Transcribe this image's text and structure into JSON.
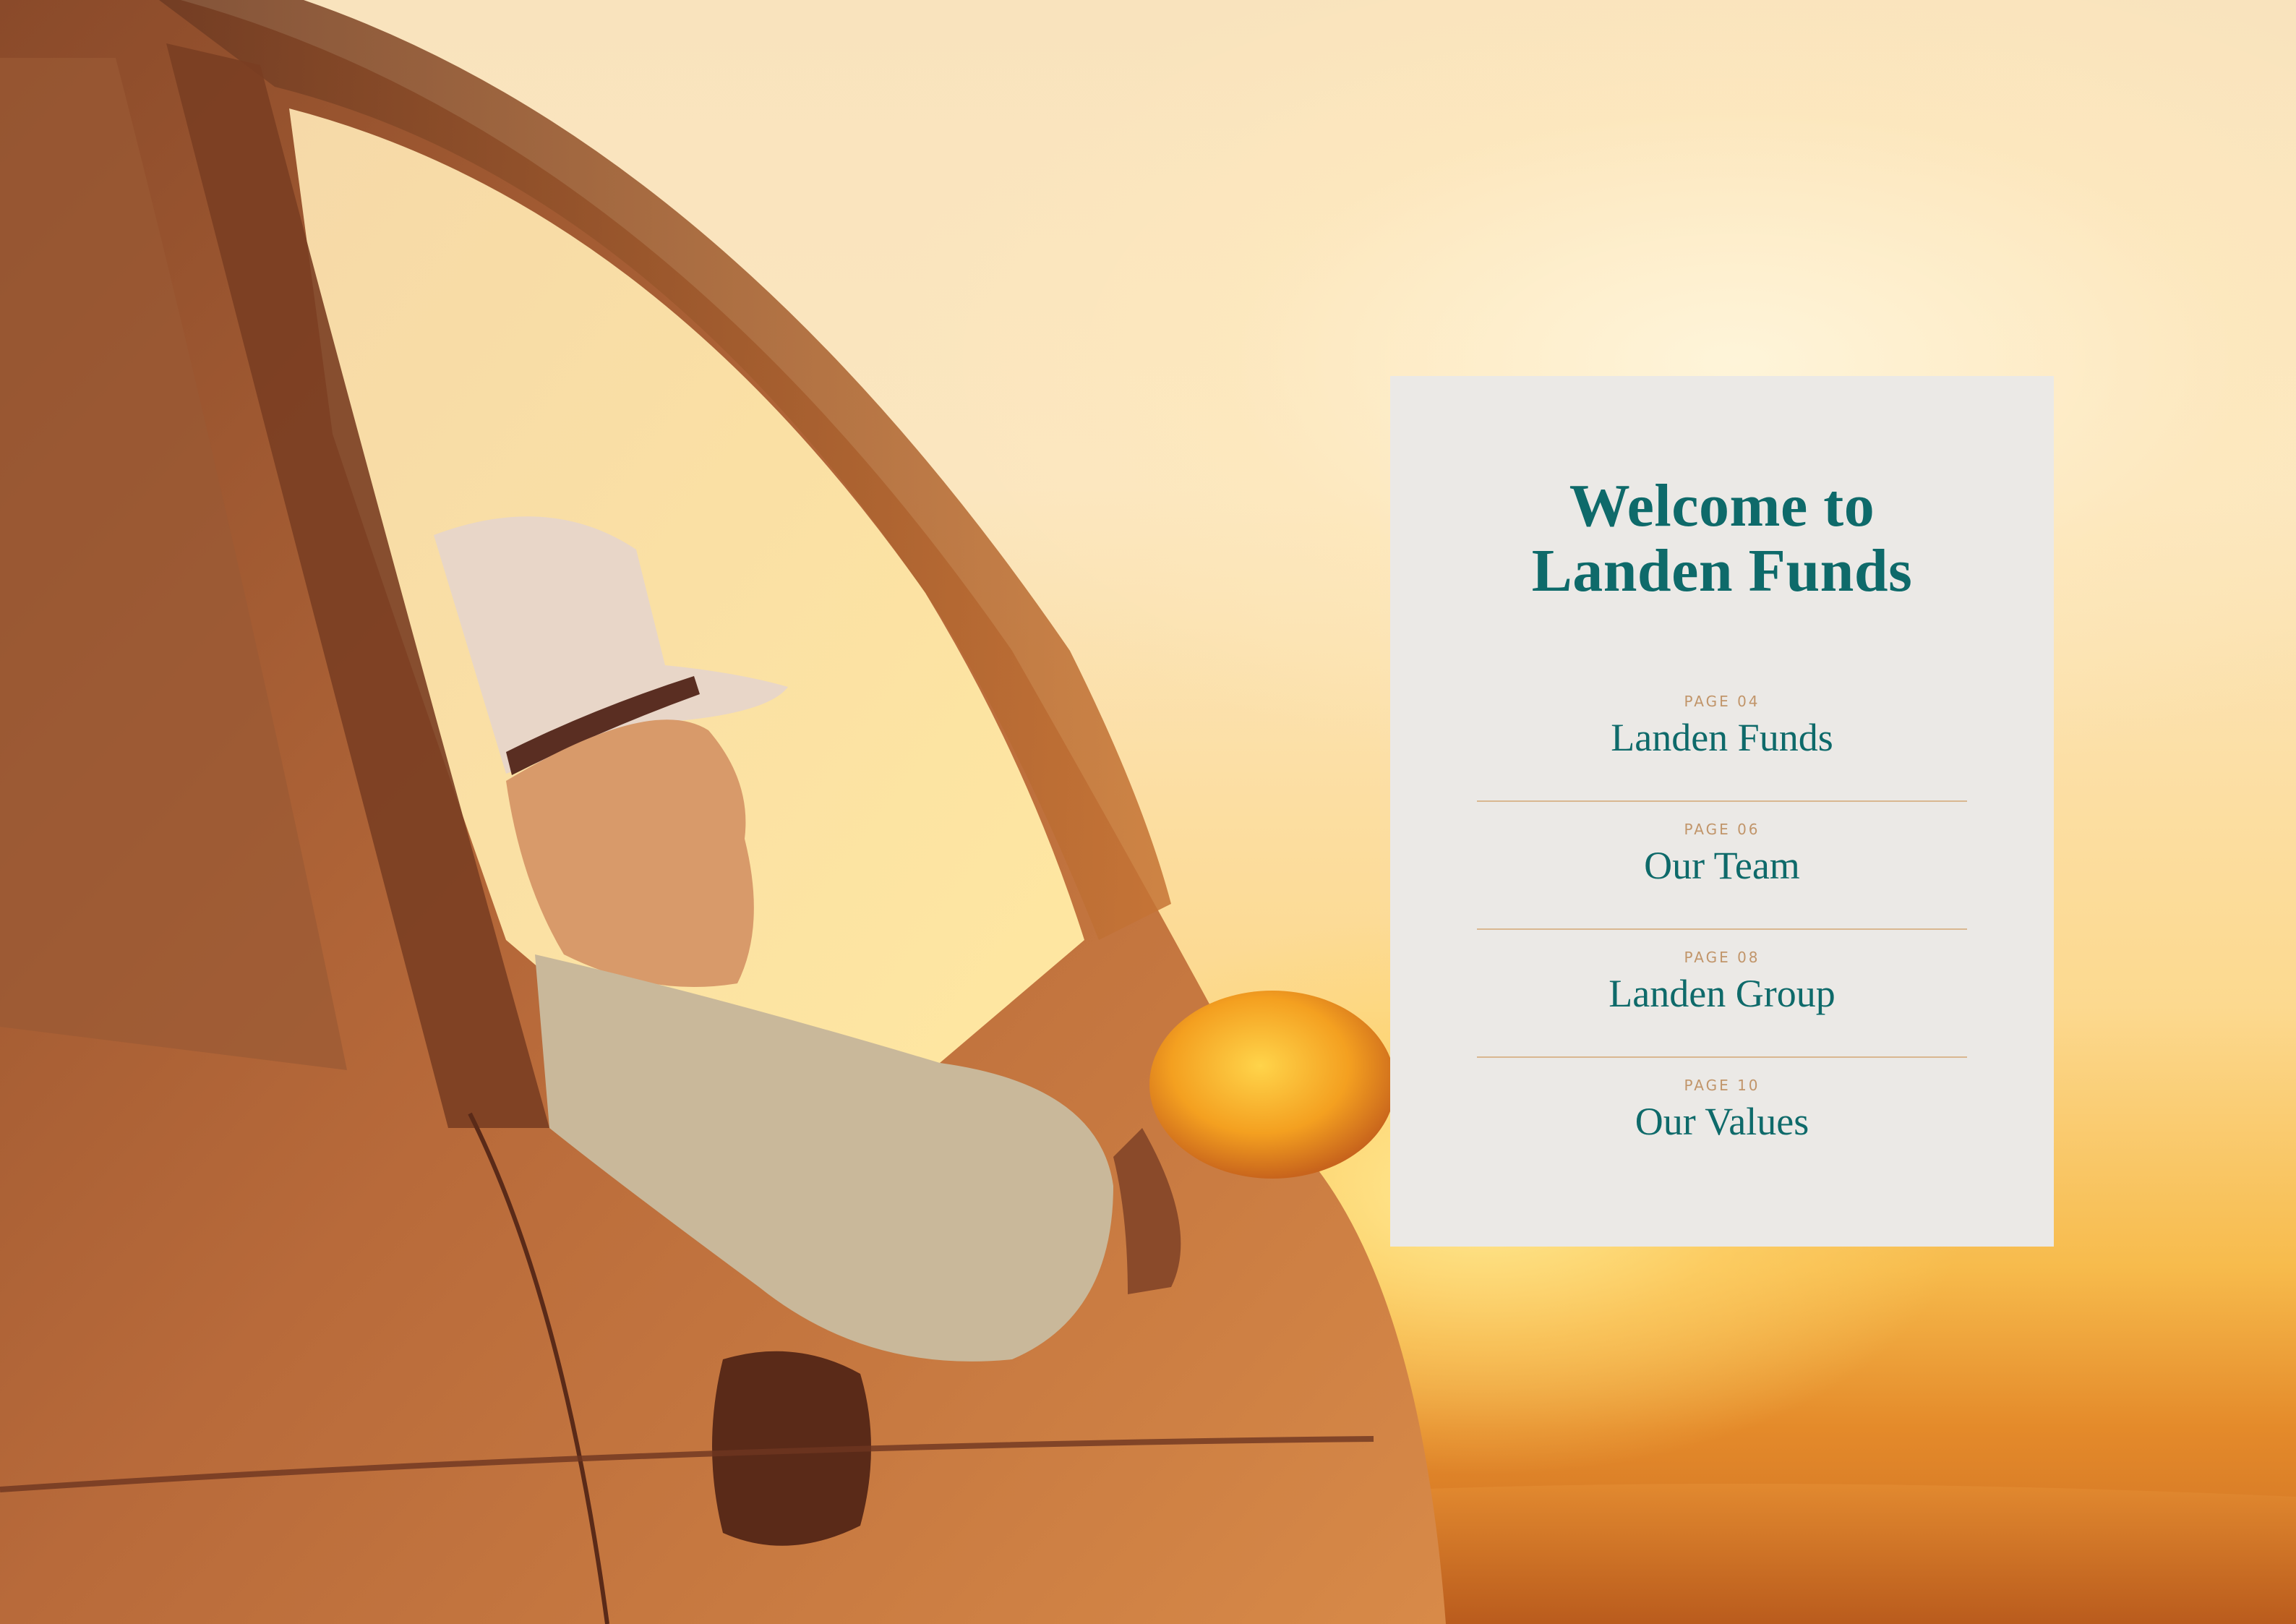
{
  "card": {
    "title_line1": "Welcome to",
    "title_line2": "Landen Funds"
  },
  "toc": {
    "items": [
      {
        "page": "PAGE 04",
        "name": "Landen Funds"
      },
      {
        "page": "PAGE 06",
        "name": "Our Team"
      },
      {
        "page": "PAGE 08",
        "name": "Landen Group"
      },
      {
        "page": "PAGE 10",
        "name": "Our Values"
      }
    ]
  },
  "colors": {
    "title": "#0e6a6a",
    "page_label": "#c1956a",
    "divider": "#d9b791",
    "card_background": "#ebe9e6"
  }
}
